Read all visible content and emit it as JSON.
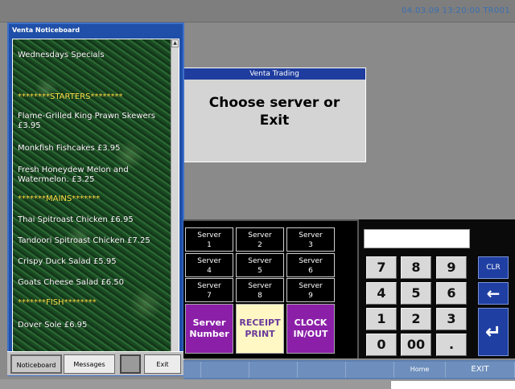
{
  "header": {
    "datetime": "04.03.09  13:20:00  TR001"
  },
  "noticeboard": {
    "title": "Venta Noticeboard",
    "lines": [
      "Wednesdays Specials",
      "********STARTERS********",
      "Flame-Grilled King Prawn Skewers £3.95",
      "Monkfish Fishcakes £3.95",
      "Fresh Honeydew Melon and Watermelon. £3.25",
      "*******MAINS*******",
      "Thai Spitroast Chicken £6.95",
      "Tandoori Spitroast Chicken £7.25",
      "Crispy Duck Salad £5.95",
      "Goats Cheese Salad £6.50",
      "*******FISH********",
      "Dover Sole £6.95"
    ],
    "tabs": {
      "noticeboard": "Noticeboard",
      "messages": "Messages",
      "exit": "Exit"
    }
  },
  "dialog": {
    "title": "Venta Trading",
    "message": "Choose server or Exit"
  },
  "servers": [
    {
      "l1": "Server",
      "l2": "1"
    },
    {
      "l1": "Server",
      "l2": "2"
    },
    {
      "l1": "Server",
      "l2": "3"
    },
    {
      "l1": "Server",
      "l2": "4"
    },
    {
      "l1": "Server",
      "l2": "5"
    },
    {
      "l1": "Server",
      "l2": "6"
    },
    {
      "l1": "Server",
      "l2": "7"
    },
    {
      "l1": "Server",
      "l2": "8"
    },
    {
      "l1": "Server",
      "l2": "9"
    }
  ],
  "actions": {
    "server_number": {
      "l1": "Server",
      "l2": "Number"
    },
    "receipt_print": {
      "l1": "RECEIPT",
      "l2": "PRINT"
    },
    "clock": {
      "l1": "CLOCK",
      "l2": "IN/OUT"
    }
  },
  "numpad": {
    "display": "",
    "keys": [
      "7",
      "8",
      "9",
      "4",
      "5",
      "6",
      "1",
      "2",
      "3",
      "0",
      "00",
      "."
    ],
    "clr": "CLR",
    "back_icon": "←",
    "enter_icon": "↵"
  },
  "statusbar": {
    "home": "Home",
    "exit": "EXIT"
  },
  "colors": {
    "accent_blue": "#1f3fa3",
    "server_number_bg": "#8b1fa8",
    "receipt_bg": "#fff8c4",
    "clock_bg": "#8b1fa8",
    "board_text_yellow": "#ffe94a"
  }
}
